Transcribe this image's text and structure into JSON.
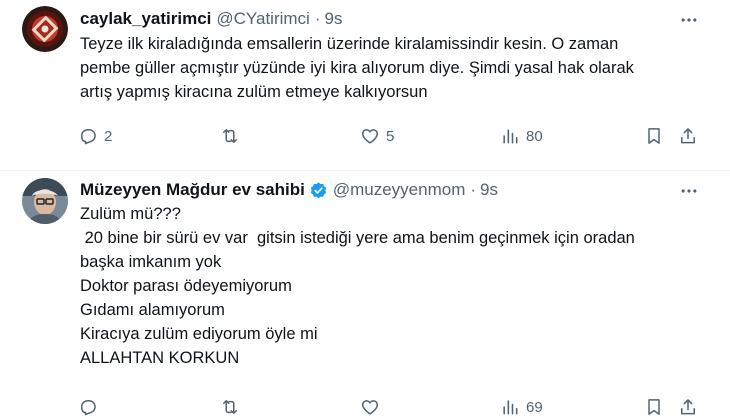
{
  "tweets": [
    {
      "display_name": "caylak_yatirimci",
      "handle": "@CYatirimci",
      "separator": "·",
      "time": "9s",
      "lines": [
        "Teyze ilk kiraladığında emsallerin üzerinde kiralamissindir kesin. O zaman",
        "pembe güller açmıştır yüzünde iyi kira alıyorum diye. Şimdi yasal hak olarak",
        "artış yapmış kiracına zulüm etmeye kalkıyorsun"
      ],
      "stats": {
        "replies": "2",
        "retweets": "",
        "likes": "5",
        "views": "80"
      }
    },
    {
      "display_name": "Müzeyyen Mağdur ev sahibi",
      "handle": "@muzeyyenmom",
      "separator": "·",
      "time": "9s",
      "verified": true,
      "lines": [
        "Zulüm mü???",
        " 20 bine bir sürü ev var  gitsin istediği yere ama benim geçinmek için oradan",
        "başka imkanım yok",
        "Doktor parası ödeyemiyorum",
        "Gıdamı alamıyorum",
        "Kiracıya zulüm ediyorum öyle mi",
        "ALLAHTAN KORKUN"
      ],
      "stats": {
        "replies": "",
        "retweets": "",
        "likes": "",
        "views": "69"
      }
    }
  ],
  "icons": {
    "more": "more-icon",
    "reply": "reply-icon",
    "retweet": "retweet-icon",
    "like": "heart-icon",
    "views": "views-icon",
    "bookmark": "bookmark-icon",
    "share": "share-icon",
    "verified": "verified-badge-icon"
  },
  "colors": {
    "text": "#0f1419",
    "secondary": "#536471",
    "verified": "#1d9bf0",
    "divider": "#eff3f4"
  }
}
